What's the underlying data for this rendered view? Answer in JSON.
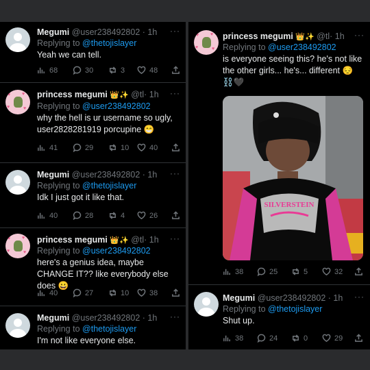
{
  "left_panel": {
    "tweets": [
      {
        "name": "Megumi",
        "handle": "@user238492802 · 1h",
        "more": "···",
        "replying_prefix": "Replying to",
        "replying_to": "@thetojislayer",
        "text": "Yeah we can tell.",
        "stats": {
          "views": "68",
          "replies": "30",
          "retweets": "3",
          "likes": "48"
        }
      },
      {
        "name": "princess megumi",
        "badges": "👑✨",
        "handle": "@tl· 1h",
        "more": "···",
        "replying_prefix": "Replying to",
        "replying_to": "@user238492802",
        "text": "why the hell is ur username so ugly, user2828281919 porcupine 😁",
        "stats": {
          "views": "41",
          "replies": "29",
          "retweets": "10",
          "likes": "40"
        }
      },
      {
        "name": "Megumi",
        "handle": "@user238492802 · 1h",
        "more": "···",
        "replying_prefix": "Replying to",
        "replying_to": "@thetojislayer",
        "text": "Idk I just got it like that.",
        "stats": {
          "views": "40",
          "replies": "28",
          "retweets": "4",
          "likes": "26"
        }
      },
      {
        "name": "princess megumi",
        "badges": "👑✨",
        "handle": "@tl· 1h",
        "more": "···",
        "replying_prefix": "Replying to",
        "replying_to": "@user238492802",
        "text": "here's a genius idea, maybe CHANGE IT?? like everybody else does 😀",
        "stats": {
          "views": "40",
          "replies": "27",
          "retweets": "10",
          "likes": "38"
        }
      },
      {
        "name": "Megumi",
        "handle": "@user238492802 · 1h",
        "more": "···",
        "replying_prefix": "Replying to",
        "replying_to": "@thetojislayer",
        "text": "I'm not like everyone else."
      }
    ]
  },
  "right_panel": {
    "tweets": [
      {
        "name": "princess megumi",
        "badges": "👑✨",
        "handle": "@tl· 1h",
        "more": "···",
        "replying_prefix": "Replying to",
        "replying_to": "@user238492802",
        "text": "is everyone seeing this? he's not like the other girls... he's... different 😔⛓️🖤",
        "photo_shirt_text": "SILVERSTEIN",
        "stats": {
          "views": "38",
          "replies": "25",
          "retweets": "5",
          "likes": "32"
        }
      },
      {
        "name": "Megumi",
        "handle": "@user238492802 · 1h",
        "more": "···",
        "replying_prefix": "Replying to",
        "replying_to": "@thetojislayer",
        "text": "Shut up.",
        "stats": {
          "views": "38",
          "replies": "24",
          "retweets": "0",
          "likes": "29"
        }
      }
    ]
  },
  "icons": [
    "views-icon",
    "reply-icon",
    "retweet-icon",
    "like-icon",
    "share-icon"
  ],
  "colors": {
    "background": "#000000",
    "frame": "#2a2b2d",
    "mention": "#1d9bf0",
    "muted": "#71767b",
    "text": "#e7e9ea"
  }
}
